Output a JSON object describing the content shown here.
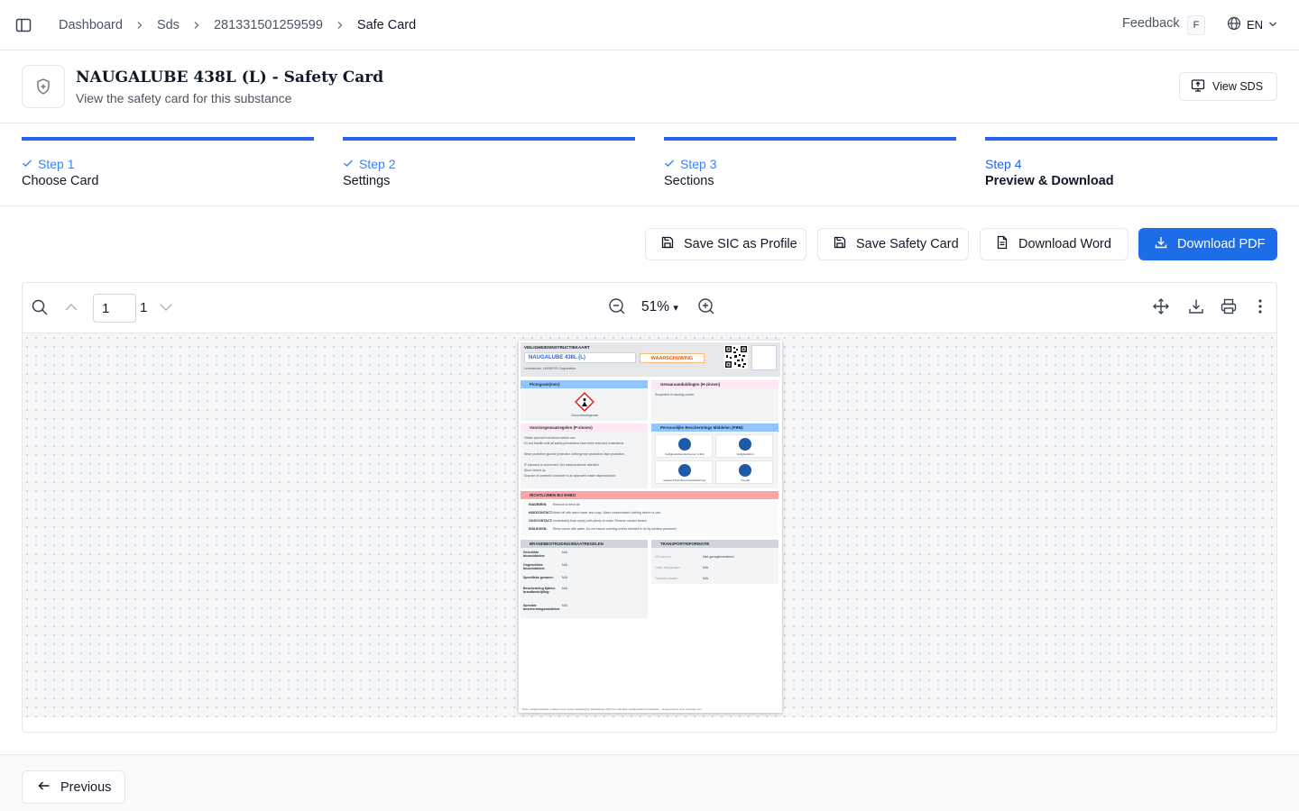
{
  "topbar": {
    "breadcrumbs": [
      "Dashboard",
      "Sds",
      "281331501259599",
      "Safe Card"
    ],
    "feedback_label": "Feedback",
    "feedback_shortcut": "F",
    "language": "EN"
  },
  "header": {
    "title": "NAUGALUBE 438L (L) - Safety Card",
    "subtitle": "View the safety card for this substance",
    "view_sds_label": "View SDS"
  },
  "stepper": {
    "steps": [
      {
        "number": "Step 1",
        "name": "Choose Card",
        "state": "done"
      },
      {
        "number": "Step 2",
        "name": "Settings",
        "state": "done"
      },
      {
        "number": "Step 3",
        "name": "Sections",
        "state": "done"
      },
      {
        "number": "Step 4",
        "name": "Preview & Download",
        "state": "active"
      }
    ],
    "accent_color": "#2563eb"
  },
  "actions": {
    "save_sic_profile": "Save SIC as Profile",
    "save_safety_card": "Save Safety Card",
    "download_word": "Download Word",
    "download_pdf": "Download PDF"
  },
  "viewer": {
    "current_page": "1",
    "total_pages": "1",
    "zoom": "51%"
  },
  "document": {
    "header_title": "VEILIGHEIDSINSTRUCTIEKAART",
    "product_name": "NAUGALUBE 438L (L)",
    "signal_word": "WAARSCHUWING",
    "supplier": "Leverancier: LANXESS Corporation",
    "sections": {
      "pictograms": "Pictogram(men)",
      "hazards": "Gevaaraanduidingen (H-zinnen)",
      "precautions": "Voorzorgsmaatregelen (P-zinnen)",
      "ppe": "Persoonlijke Beschermings Middelen (PBM)",
      "first_aid": "RICHTLIJNEN BIJ EHBO",
      "firefighting": "BRANDBESTRIJDINGSMAATREGELEN",
      "transport": "TRANSPORTINFORMATIE"
    },
    "pictogram_caption": "Gezondheidsgevaar",
    "hazard_text": "Suspected of causing cancer.",
    "precaution_lines": [
      "Obtain special instructions before use.",
      "Do not handle until all safety precautions have been read and understood.",
      "Wear protective gloves/ protective clothing/ eye protection/ face protection.",
      "IF exposed or concerned: Get medical advice/ attention.",
      "Store locked up.",
      "Dispose of contents/ container to an approved waste disposal plant."
    ],
    "ppe_items": [
      "Veiligheidshandschoenen (nitril)",
      "Veiligheidsbril",
      "Gelaat-/Huid-/Zuurstofbeschermer",
      "Overall"
    ],
    "first_aid_rows": [
      {
        "label": "INADEMEN:",
        "text": "Remove to fresh air."
      },
      {
        "label": "HUIDCONTACT:",
        "text": "Wash off with warm water and soap. Wash contaminated clothing before re-use."
      },
      {
        "label": "OOGCONTACT:",
        "text": "Immediately flush eye(s) with plenty of water. Remove contact lenses."
      },
      {
        "label": "INSLIKKEN:",
        "text": "Rinse mouth with water. Do not induce vomiting unless directed to do by medical personnel."
      }
    ],
    "fire_rows": [
      {
        "label": "Geschikte blusmiddelen:",
        "value": "N/A"
      },
      {
        "label": "Ongeschikte blusmiddelen:",
        "value": "N/A"
      },
      {
        "label": "Specifieke gevaren:",
        "value": "N/A"
      },
      {
        "label": "Bescherming tijdens brandbestrijding:",
        "value": "N/A"
      },
      {
        "label": "Speciale beschermingsmiddelen:",
        "value": "N/A"
      }
    ],
    "transport_rows": [
      {
        "label": "VN nummer:",
        "value": "Niet gereglementeerd"
      },
      {
        "label": "Juiste ladingnaam:",
        "value": "N/A"
      },
      {
        "label": "Transport klasse:",
        "value": "N/A"
      }
    ],
    "footer_text": "Deze veiligheidskaart is alleen voor snelle raadpleging. Raadpleeg altijd het volledige veiligheidsinformatieblad... Gegenereerd door nmtrade.com"
  },
  "footer": {
    "previous_label": "Previous"
  }
}
